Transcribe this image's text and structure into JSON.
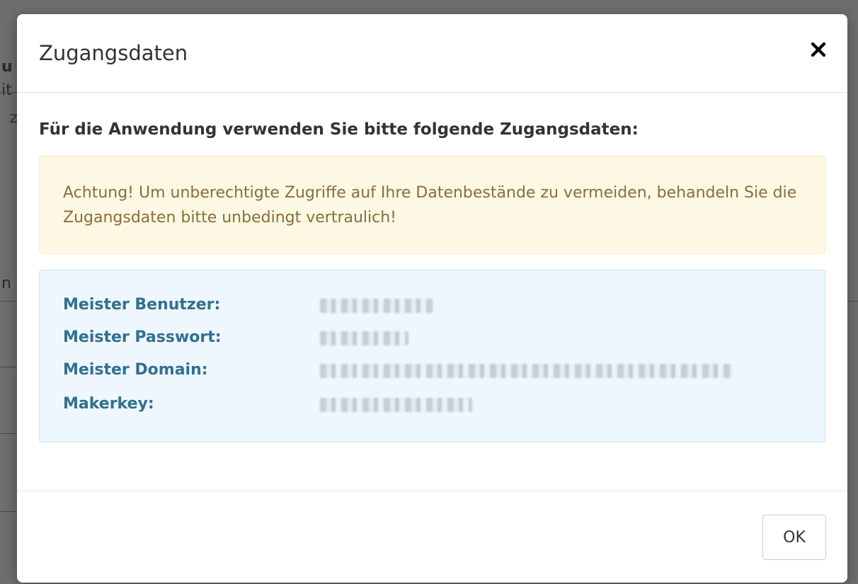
{
  "modal": {
    "title": "Zugangsdaten",
    "close_icon": "close-icon",
    "intro": "Für die Anwendung verwenden Sie bitte folgende Zugangsdaten:",
    "warning": "Achtung! Um unberechtigte Zugriffe auf Ihre Datenbestände zu vermeiden, behandeln Sie die Zugangsdaten bitte unbedingt vertraulich!",
    "credentials": [
      {
        "label": "Meister Benutzer:",
        "value_obscured": true
      },
      {
        "label": "Meister Passwort:",
        "value_obscured": true
      },
      {
        "label": "Meister Domain:",
        "value_obscured": true
      },
      {
        "label": "Makerkey:",
        "value_obscured": true
      }
    ],
    "ok_label": "OK"
  },
  "background": {
    "fragments": [
      "u",
      "it",
      "Z",
      "n"
    ]
  },
  "colors": {
    "backdrop": "#6e6e6e",
    "warning_bg": "#fcf8e3",
    "warning_text": "#8a6d3b",
    "info_bg": "#eef7fd",
    "info_border": "#bce8f1",
    "info_label": "#31708f"
  }
}
